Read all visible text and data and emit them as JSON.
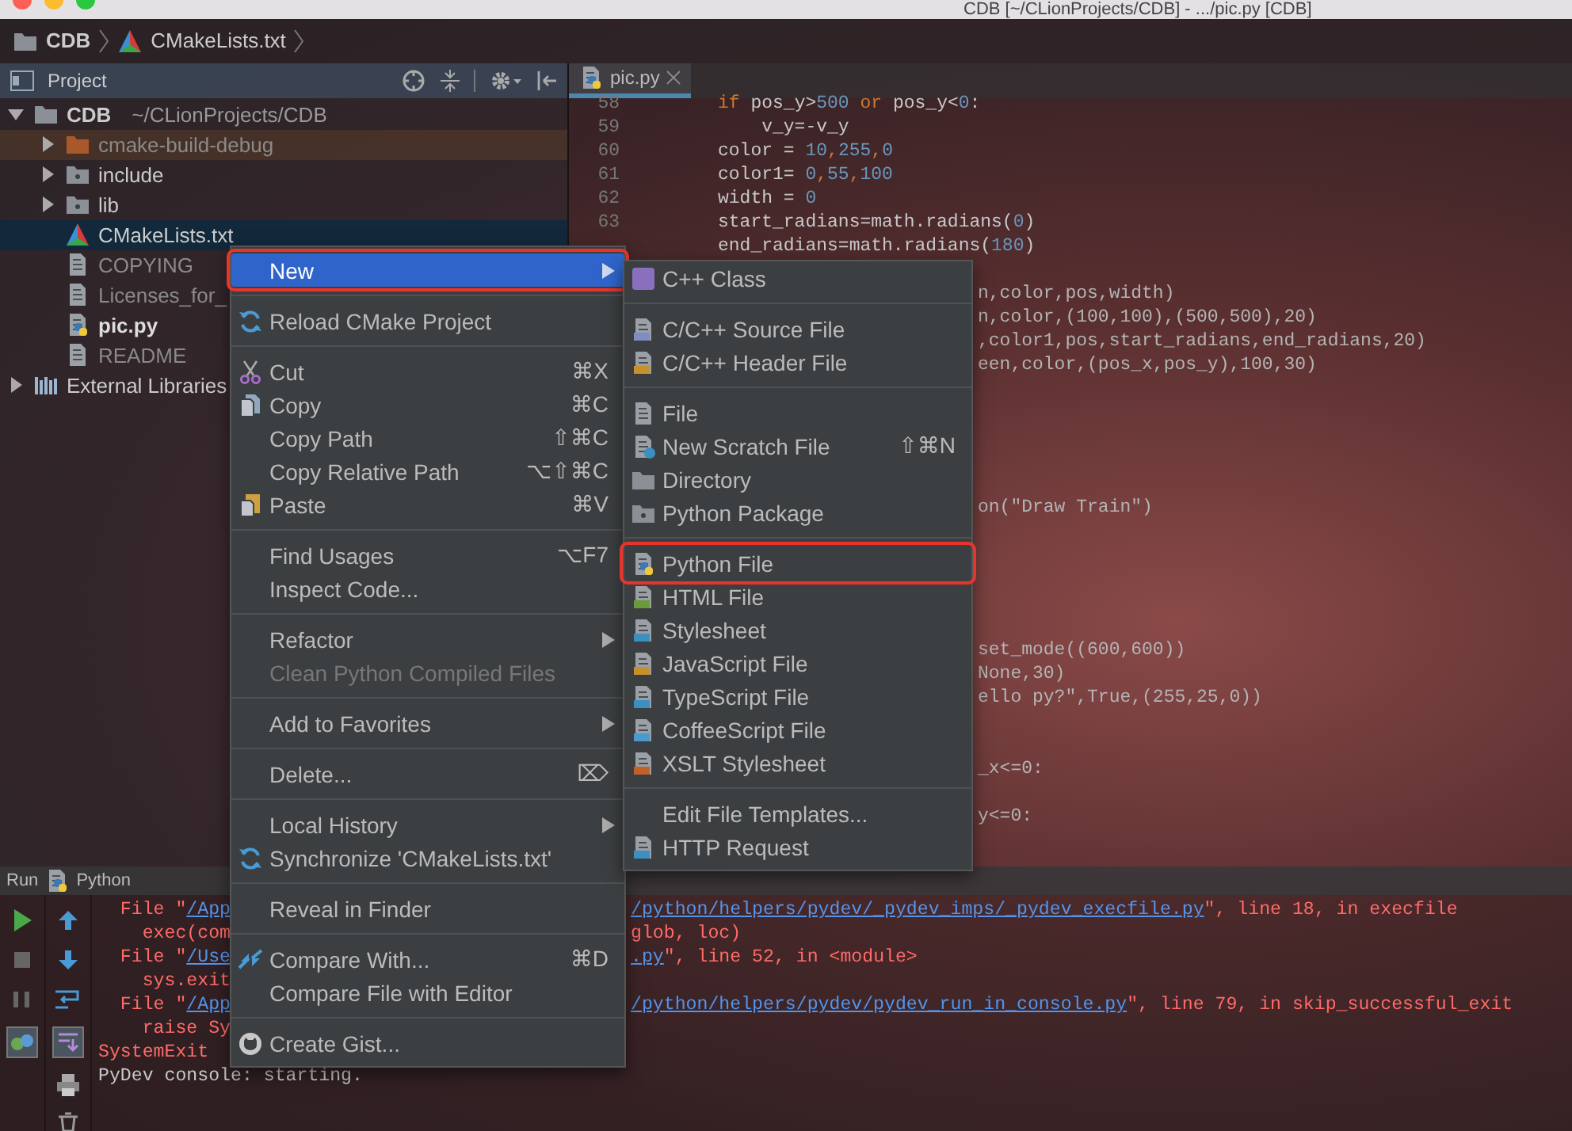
{
  "window": {
    "title": "CDB [~/CLionProjects/CDB] - .../pic.py [CDB]"
  },
  "breadcrumbs": [
    {
      "label": "CDB",
      "kind": "folder"
    },
    {
      "label": "CMakeLists.txt",
      "kind": "cmake"
    }
  ],
  "project_panel": {
    "title": "Project",
    "tree": [
      {
        "label": "CDB",
        "path": "~/CLionProjects/CDB",
        "kind": "folder",
        "expanded": true,
        "selected": false,
        "dimmed": false,
        "children": [
          {
            "label": "cmake-build-debug",
            "kind": "excluded",
            "expanded": false,
            "selected": false,
            "dimmed": true
          },
          {
            "label": "include",
            "kind": "package",
            "expanded": false,
            "selected": false,
            "dimmed": false
          },
          {
            "label": "lib",
            "kind": "package",
            "expanded": false,
            "selected": false,
            "dimmed": false
          },
          {
            "label": "CMakeLists.txt",
            "kind": "cmake",
            "selected": true,
            "dimmed": false
          },
          {
            "label": "COPYING",
            "kind": "text",
            "selected": false,
            "dimmed": true
          },
          {
            "label": "Licenses_for_",
            "kind": "text",
            "selected": false,
            "dimmed": true
          },
          {
            "label": "pic.py",
            "kind": "python",
            "selected": false,
            "dimmed": false
          },
          {
            "label": "README",
            "kind": "text",
            "selected": false,
            "dimmed": true
          }
        ]
      },
      {
        "label": "External Libraries",
        "kind": "libraries",
        "expanded": false,
        "selected": false,
        "dimmed": false
      }
    ]
  },
  "editor": {
    "tabs": [
      {
        "label": "pic.py",
        "selected": true
      }
    ],
    "lines": [
      {
        "kind": "full",
        "number": "58",
        "tokens": [
          {
            "text": "if",
            "kind": "keyword"
          },
          {
            "text": " pos_y>",
            "kind": "plain"
          },
          {
            "text": "500",
            "kind": "number"
          },
          {
            "text": " or",
            "kind": "keyword"
          },
          {
            "text": " pos_y<",
            "kind": "plain"
          },
          {
            "text": "0",
            "kind": "number"
          },
          {
            "text": ":",
            "kind": "plain"
          }
        ]
      },
      {
        "kind": "full",
        "number": "59",
        "tokens": [
          {
            "text": "    v_y=-v_y",
            "kind": "plain"
          }
        ]
      },
      {
        "kind": "full",
        "number": "60",
        "tokens": [
          {
            "text": "color = ",
            "kind": "plain"
          },
          {
            "text": "10",
            "kind": "number"
          },
          {
            "text": ",",
            "kind": "keyword"
          },
          {
            "text": "255",
            "kind": "number"
          },
          {
            "text": ",",
            "kind": "keyword"
          },
          {
            "text": "0",
            "kind": "number"
          }
        ]
      },
      {
        "kind": "full",
        "number": "61",
        "tokens": [
          {
            "text": "color1= ",
            "kind": "plain"
          },
          {
            "text": "0",
            "kind": "number"
          },
          {
            "text": ",",
            "kind": "keyword"
          },
          {
            "text": "55",
            "kind": "number"
          },
          {
            "text": ",",
            "kind": "keyword"
          },
          {
            "text": "100",
            "kind": "number"
          }
        ]
      },
      {
        "kind": "full",
        "number": "62",
        "tokens": [
          {
            "text": "width = ",
            "kind": "plain"
          },
          {
            "text": "0",
            "kind": "number"
          }
        ]
      },
      {
        "kind": "full",
        "number": "63",
        "tokens": [
          {
            "text": "start_radians=math.radians(",
            "kind": "plain"
          },
          {
            "text": "0",
            "kind": "number"
          },
          {
            "text": ")",
            "kind": "plain"
          }
        ]
      },
      {
        "kind": "full",
        "tokens": [
          {
            "text": "end_radians=math.radians(",
            "kind": "plain"
          },
          {
            "text": "180",
            "kind": "number"
          },
          {
            "text": ")",
            "kind": "plain"
          }
        ]
      },
      {
        "kind": "blank"
      },
      {
        "kind": "clipped",
        "text": "n,color,pos,width)"
      },
      {
        "kind": "clipped",
        "text": "n,color,(100,100),(500,500),20)"
      },
      {
        "kind": "clipped",
        "text": ",color1,pos,start_radians,end_radians,20)"
      },
      {
        "kind": "clipped",
        "text": "een,color,(pos_x,pos_y),100,30)"
      },
      {
        "kind": "blank"
      },
      {
        "kind": "blank"
      },
      {
        "kind": "blank"
      },
      {
        "kind": "blank"
      },
      {
        "kind": "blank"
      },
      {
        "kind": "clipped",
        "text": "on(\"Draw Train\")"
      },
      {
        "kind": "blank"
      },
      {
        "kind": "blank"
      },
      {
        "kind": "blank"
      },
      {
        "kind": "blank"
      },
      {
        "kind": "blank"
      },
      {
        "kind": "clipped",
        "text": "set_mode((600,600))"
      },
      {
        "kind": "clipped",
        "text": "None,30)"
      },
      {
        "kind": "clipped",
        "text": "ello py?\",True,(255,25,0))"
      },
      {
        "kind": "blank"
      },
      {
        "kind": "blank"
      },
      {
        "kind": "clipped",
        "text": "_x<=0:"
      },
      {
        "kind": "blank"
      },
      {
        "kind": "clipped",
        "text": "y<=0:"
      }
    ]
  },
  "context_menu": [
    {
      "kind": "plain",
      "label": "New",
      "submenu": true,
      "selected": true,
      "annotated": true,
      "disabled": false
    },
    {
      "kind": "separator"
    },
    {
      "kind": "reload",
      "label": "Reload CMake Project",
      "submenu": false,
      "selected": false,
      "annotated": false,
      "disabled": false
    },
    {
      "kind": "separator"
    },
    {
      "kind": "cut",
      "label": "Cut",
      "shortcut": "⌘X",
      "submenu": false,
      "selected": false,
      "annotated": false,
      "disabled": false
    },
    {
      "kind": "copy",
      "label": "Copy",
      "shortcut": "⌘C",
      "submenu": false,
      "selected": false,
      "annotated": false,
      "disabled": false
    },
    {
      "kind": "plain",
      "label": "Copy Path",
      "shortcut": "⇧⌘C",
      "submenu": false,
      "selected": false,
      "annotated": false,
      "disabled": false
    },
    {
      "kind": "plain",
      "label": "Copy Relative Path",
      "shortcut": "⌥⇧⌘C",
      "submenu": false,
      "selected": false,
      "annotated": false,
      "disabled": false
    },
    {
      "kind": "paste",
      "label": "Paste",
      "shortcut": "⌘V",
      "submenu": false,
      "selected": false,
      "annotated": false,
      "disabled": false
    },
    {
      "kind": "separator"
    },
    {
      "kind": "plain",
      "label": "Find Usages",
      "shortcut": "⌥F7",
      "submenu": false,
      "selected": false,
      "annotated": false,
      "disabled": false
    },
    {
      "kind": "plain",
      "label": "Inspect Code...",
      "submenu": false,
      "selected": false,
      "annotated": false,
      "disabled": false
    },
    {
      "kind": "separator"
    },
    {
      "kind": "plain",
      "label": "Refactor",
      "submenu": true,
      "selected": false,
      "annotated": false,
      "disabled": false
    },
    {
      "kind": "plain",
      "label": "Clean Python Compiled Files",
      "submenu": false,
      "selected": false,
      "annotated": false,
      "disabled": true
    },
    {
      "kind": "separator"
    },
    {
      "kind": "plain",
      "label": "Add to Favorites",
      "submenu": true,
      "selected": false,
      "annotated": false,
      "disabled": false
    },
    {
      "kind": "separator"
    },
    {
      "kind": "plain",
      "label": "Delete...",
      "shortcut": "⌦",
      "submenu": false,
      "selected": false,
      "annotated": false,
      "disabled": false
    },
    {
      "kind": "separator"
    },
    {
      "kind": "plain",
      "label": "Local History",
      "submenu": true,
      "selected": false,
      "annotated": false,
      "disabled": false
    },
    {
      "kind": "reload",
      "label": "Synchronize 'CMakeLists.txt'",
      "submenu": false,
      "selected": false,
      "annotated": false,
      "disabled": false
    },
    {
      "kind": "separator"
    },
    {
      "kind": "plain",
      "label": "Reveal in Finder",
      "submenu": false,
      "selected": false,
      "annotated": false,
      "disabled": false
    },
    {
      "kind": "separator"
    },
    {
      "kind": "compare",
      "label": "Compare With...",
      "shortcut": "⌘D",
      "submenu": false,
      "selected": false,
      "annotated": false,
      "disabled": false
    },
    {
      "kind": "plain",
      "label": "Compare File with Editor",
      "submenu": false,
      "selected": false,
      "annotated": false,
      "disabled": false
    },
    {
      "kind": "separator"
    },
    {
      "kind": "gist",
      "label": "Create Gist...",
      "submenu": false,
      "selected": false,
      "annotated": false,
      "disabled": false
    }
  ],
  "new_submenu": [
    {
      "kind": "class",
      "label": "C++ Class",
      "selected": false,
      "annotated": false
    },
    {
      "kind": "separator"
    },
    {
      "kind": "source",
      "label": "C/C++ Source File",
      "selected": false,
      "annotated": false
    },
    {
      "kind": "header",
      "label": "C/C++ Header File",
      "selected": false,
      "annotated": false
    },
    {
      "kind": "separator"
    },
    {
      "kind": "file",
      "label": "File",
      "selected": false,
      "annotated": false
    },
    {
      "kind": "scratch",
      "label": "New Scratch File",
      "shortcut": "⇧⌘N",
      "selected": false,
      "annotated": false
    },
    {
      "kind": "directory",
      "label": "Directory",
      "selected": false,
      "annotated": false
    },
    {
      "kind": "package",
      "label": "Python Package",
      "selected": false,
      "annotated": false
    },
    {
      "kind": "separator"
    },
    {
      "kind": "python",
      "label": "Python File",
      "selected": false,
      "annotated": true
    },
    {
      "kind": "html",
      "label": "HTML File",
      "selected": false,
      "annotated": false
    },
    {
      "kind": "css",
      "label": "Stylesheet",
      "selected": false,
      "annotated": false
    },
    {
      "kind": "js",
      "label": "JavaScript File",
      "selected": false,
      "annotated": false
    },
    {
      "kind": "ts",
      "label": "TypeScript File",
      "selected": false,
      "annotated": false
    },
    {
      "kind": "coffee",
      "label": "CoffeeScript File",
      "selected": false,
      "annotated": false
    },
    {
      "kind": "xslt",
      "label": "XSLT Stylesheet",
      "selected": false,
      "annotated": false
    },
    {
      "kind": "separator"
    },
    {
      "kind": "plain",
      "label": "Edit File Templates...",
      "selected": false,
      "annotated": false
    },
    {
      "kind": "api",
      "label": "HTTP Request",
      "selected": false,
      "annotated": false
    }
  ],
  "run_panel": {
    "title": "Run",
    "config": "Python",
    "lines": [
      {
        "kind": "error",
        "left": [
          {
            "text": "  File \"",
            "link": false
          },
          {
            "text": "/App",
            "link": true
          }
        ],
        "right": [
          {
            "text": "/python/helpers/pydev/_pydev_imps/_pydev_execfile.py",
            "link": true
          },
          {
            "text": "\", line 18, in execfile",
            "link": false
          }
        ]
      },
      {
        "kind": "error",
        "left": [
          {
            "text": "    exec(com",
            "link": false
          }
        ],
        "right": [
          {
            "text": "glob, loc)",
            "link": false
          }
        ]
      },
      {
        "kind": "error",
        "left": [
          {
            "text": "  File \"",
            "link": false
          },
          {
            "text": "/Use",
            "link": true
          }
        ],
        "right": [
          {
            "text": ".py",
            "link": true
          },
          {
            "text": "\", line 52, in <module>",
            "link": false
          }
        ]
      },
      {
        "kind": "error",
        "left": [
          {
            "text": "    sys.exit",
            "link": false
          }
        ]
      },
      {
        "kind": "error",
        "left": [
          {
            "text": "  File \"",
            "link": false
          },
          {
            "text": "/App",
            "link": true
          }
        ],
        "right": [
          {
            "text": "/python/helpers/pydev/pydev_run_in_console.py",
            "link": true
          },
          {
            "text": "\", line 79, in skip_successful_exit",
            "link": false
          }
        ]
      },
      {
        "kind": "error",
        "left": [
          {
            "text": "    raise Sy",
            "link": false
          }
        ]
      },
      {
        "kind": "error",
        "left": [
          {
            "text": "SystemExit",
            "link": false
          }
        ]
      },
      {
        "kind": "info",
        "left": [
          {
            "text": "PyDev console: starting.",
            "link": false
          }
        ]
      }
    ]
  }
}
